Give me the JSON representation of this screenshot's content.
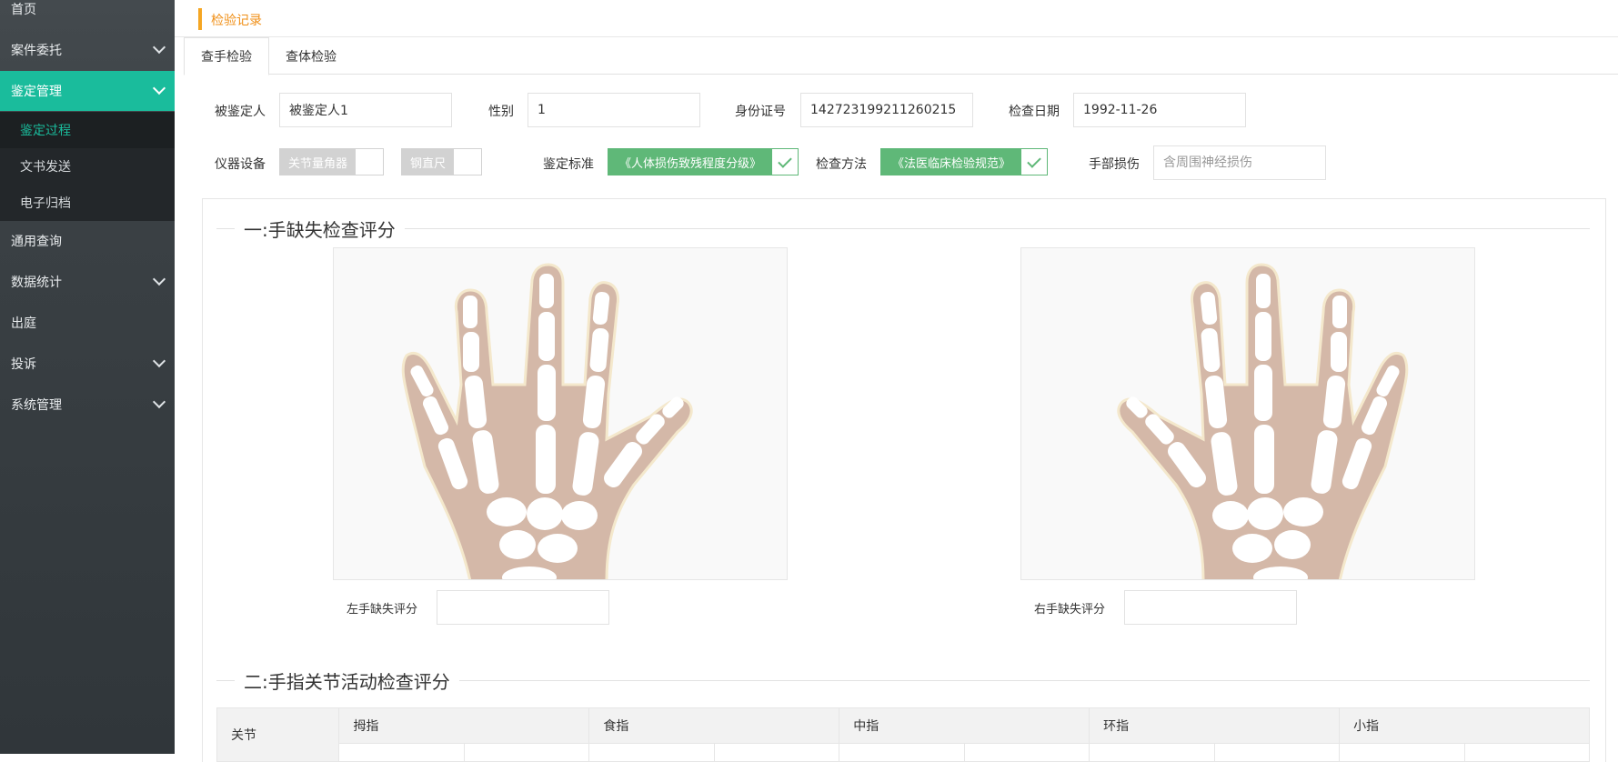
{
  "sidebar": {
    "items": [
      {
        "label": "首页"
      },
      {
        "label": "案件委托"
      },
      {
        "label": "鉴定管理"
      },
      {
        "label": "通用查询"
      },
      {
        "label": "数据统计"
      },
      {
        "label": "出庭"
      },
      {
        "label": "投诉"
      },
      {
        "label": "系统管理"
      }
    ],
    "sub_items": [
      {
        "label": "鉴定过程"
      },
      {
        "label": "文书发送"
      },
      {
        "label": "电子归档"
      }
    ]
  },
  "breadcrumb": {
    "title": "检验记录"
  },
  "tabs": [
    {
      "label": "查手检验"
    },
    {
      "label": "查体检验"
    }
  ],
  "form": {
    "subject": {
      "label": "被鉴定人",
      "value": "被鉴定人1"
    },
    "gender": {
      "label": "性别",
      "value": "1"
    },
    "id_number": {
      "label": "身份证号",
      "value": "142723199211260215"
    },
    "exam_date": {
      "label": "检查日期",
      "value": "1992-11-26"
    },
    "instruments": {
      "label": "仪器设备",
      "options": [
        "关节量角器",
        "钢直尺"
      ]
    },
    "standard": {
      "label": "鉴定标准",
      "value": "《人体损伤致残程度分级》"
    },
    "method": {
      "label": "检查方法",
      "value": "《法医临床检验规范》"
    },
    "hand_injury": {
      "label": "手部损伤",
      "placeholder": "含周围神经损伤"
    }
  },
  "section1": {
    "title": "一:手缺失检查评分",
    "left_label": "左手缺失评分",
    "right_label": "右手缺失评分"
  },
  "section2": {
    "title": "二:手指关节活动检查评分",
    "columns": [
      "关节",
      "拇指",
      "食指",
      "中指",
      "环指",
      "小指"
    ]
  },
  "colors": {
    "accent": "#1abc9c",
    "breadcrumb_accent": "#f5a623",
    "check_green": "#5fb878",
    "bone_skin": "#d4b8a8"
  }
}
